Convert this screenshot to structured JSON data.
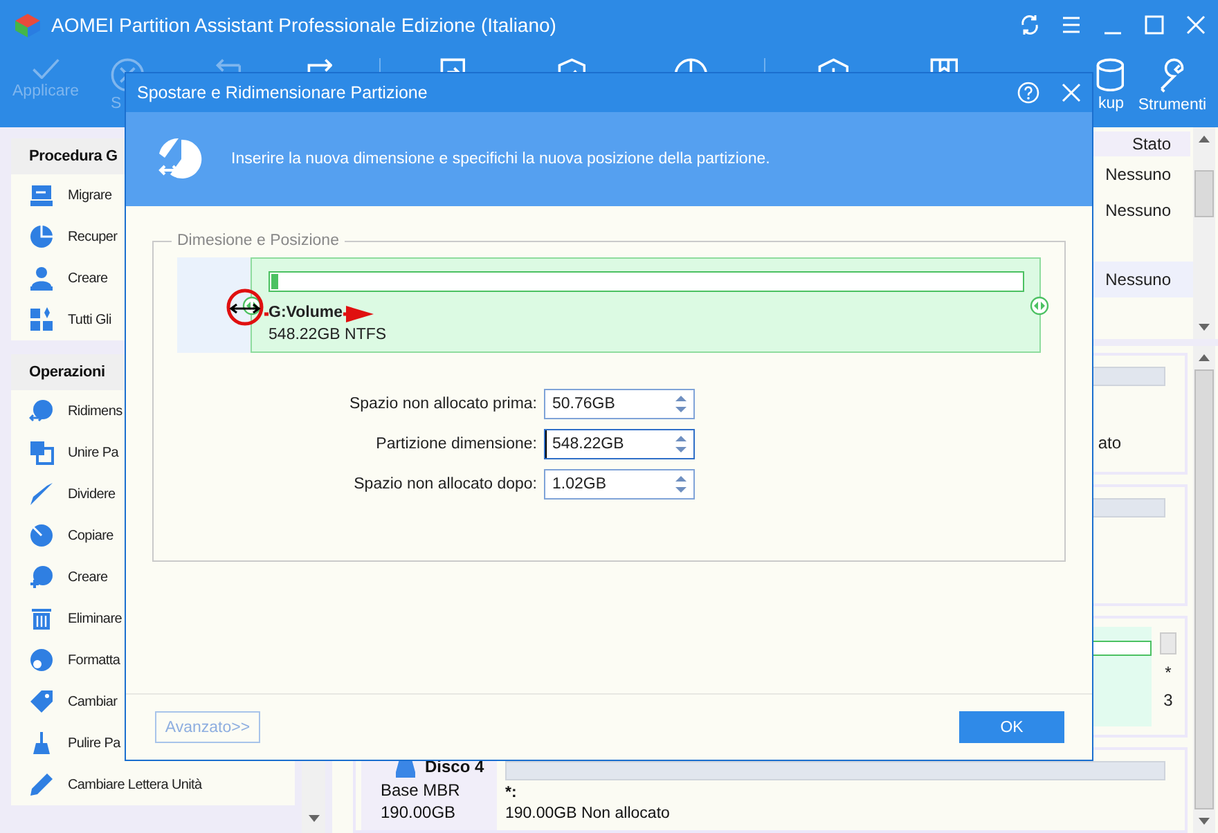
{
  "window": {
    "title": "AOMEI Partition Assistant Professionale Edizione (Italiano)"
  },
  "toolbar": [
    {
      "kind": "check",
      "label": "Applicare",
      "disabled": true
    },
    {
      "kind": "discard",
      "label": "S",
      "disabled": true
    },
    {
      "kind": "undo",
      "disabled": true
    },
    {
      "kind": "redo",
      "disabled": false
    },
    {
      "kind": "sep"
    },
    {
      "kind": "document",
      "disabled": false
    },
    {
      "kind": "edit",
      "disabled": false
    },
    {
      "kind": "pie",
      "disabled": false
    },
    {
      "kind": "sep"
    },
    {
      "kind": "shield",
      "disabled": false
    },
    {
      "kind": "book",
      "disabled": false
    },
    {
      "kind": "backup",
      "label": "kup",
      "disabled": false
    },
    {
      "kind": "tools",
      "label": "Strumenti",
      "disabled": false
    }
  ],
  "sidebar": {
    "sections": [
      {
        "title": "Procedura G",
        "items": [
          {
            "kind": "migrate",
            "label": "Migrare"
          },
          {
            "kind": "recover",
            "label": "Recuper"
          },
          {
            "kind": "media",
            "label": "Creare"
          },
          {
            "kind": "all",
            "label": "Tutti Gli"
          }
        ]
      },
      {
        "title": "Operazioni",
        "items": [
          {
            "kind": "resize",
            "label": "Ridimens"
          },
          {
            "kind": "merge",
            "label": "Unire Pa"
          },
          {
            "kind": "split",
            "label": "Dividere"
          },
          {
            "kind": "copy",
            "label": "Copiare"
          },
          {
            "kind": "create",
            "label": "Creare"
          },
          {
            "kind": "delete",
            "label": "Eliminare"
          },
          {
            "kind": "format",
            "label": "Formatta"
          },
          {
            "kind": "label",
            "label": "Cambiar"
          },
          {
            "kind": "wipe",
            "label": "Pulire Pa"
          },
          {
            "kind": "letter",
            "label": "Cambiare Lettera Unità"
          }
        ]
      }
    ]
  },
  "partition_list": {
    "column": "Stato",
    "rows": [
      {
        "status": "Nessuno",
        "selected": false
      },
      {
        "status": "Nessuno",
        "selected": false
      },
      {
        "status": "Nessuno",
        "selected": true
      }
    ]
  },
  "disk_cards": [
    {
      "kind": "partition",
      "text": "ato"
    },
    {
      "kind": "partition"
    },
    {
      "kind": "detail",
      "texts": [
        "*",
        "3"
      ]
    },
    {
      "kind": "disk",
      "name": "Disco 4",
      "type": "Base MBR",
      "size": "190.00GB",
      "partition_name": "*:",
      "partition_detail": "190.00GB Non allocato"
    }
  ],
  "dialog": {
    "title": "Spostare e Ridimensionare Partizione",
    "instruction": "Inserire la nuova dimensione e specifichi la nuova posizione della partizione.",
    "group_title": "Dimesione e Posizione",
    "unallocated_before": {
      "level": 0.085
    },
    "partition": {
      "name": "G:Volume",
      "detail": "548.22GB NTFS",
      "usage": {
        "level": 0.01
      }
    },
    "fields": [
      {
        "label": "Spazio non allocato prima:",
        "value": "50.76GB",
        "focused": false
      },
      {
        "label": "Partizione dimensione:",
        "value": "548.22GB",
        "focused": true
      },
      {
        "label": "Spazio non allocato dopo:",
        "value": "1.02GB",
        "focused": false
      }
    ],
    "buttons": [
      {
        "label": "Avanzato>>",
        "kind": "secondary"
      },
      {
        "label": "OK",
        "kind": "primary"
      }
    ]
  }
}
